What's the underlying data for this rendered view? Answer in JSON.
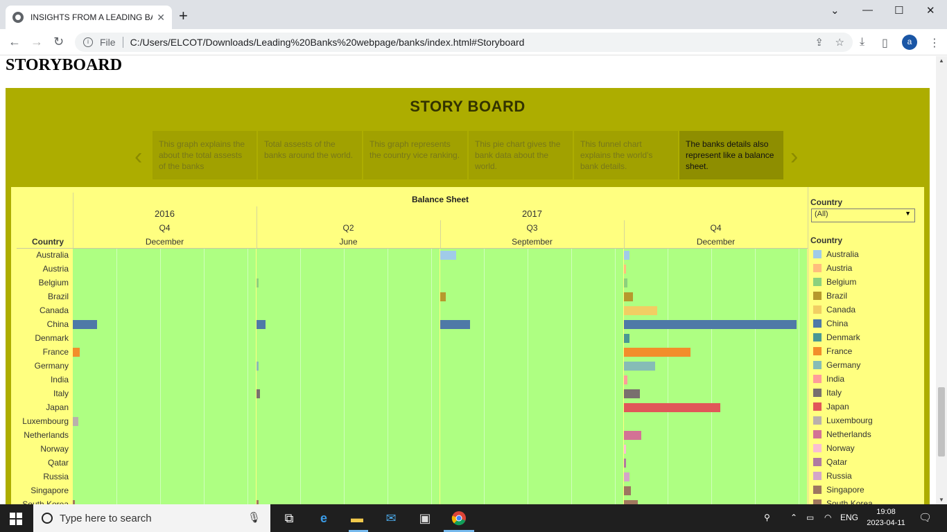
{
  "browser": {
    "tab_title": "INSIGHTS FROM A LEADING BAN",
    "new_tab": "+",
    "protocol_label": "File",
    "url": "C:/Users/ELCOT/Downloads/Leading%20Banks%20webpage/banks/index.html#Storyboard",
    "profile_initial": "a"
  },
  "page": {
    "heading": "STORYBOARD"
  },
  "story": {
    "title": "STORY BOARD",
    "points": [
      {
        "text": "This graph explains the about the total assests of the banks"
      },
      {
        "text": "Total assests of the banks around the world."
      },
      {
        "text": "This graph represents the country vice ranking."
      },
      {
        "text": "This pie chart gives the bank data about the world."
      },
      {
        "text": "This funnel chart explains the world's bank details."
      },
      {
        "text": "The banks details also represent like a balance sheet."
      }
    ]
  },
  "dashboard": {
    "filter_label": "Country",
    "filter_value": "(All)",
    "legend_title": "Country",
    "row_header": "Country"
  },
  "chart_data": {
    "type": "bar",
    "title": "Balance Sheet",
    "years": [
      "2016",
      "2017"
    ],
    "quarters": [
      "Q4",
      "Q2",
      "Q3",
      "Q4"
    ],
    "months": [
      "December",
      "June",
      "September",
      "December"
    ],
    "periods": [
      "2016 Q4 December",
      "2017 Q2 June",
      "2017 Q3 September",
      "2017 Q4 December"
    ],
    "categories": [
      "Australia",
      "Austria",
      "Belgium",
      "Brazil",
      "Canada",
      "China",
      "Denmark",
      "France",
      "Germany",
      "India",
      "Italy",
      "Japan",
      "Luxembourg",
      "Netherlands",
      "Norway",
      "Qatar",
      "Russia",
      "Singapore",
      "South Korea"
    ],
    "colors": [
      "#a0cbe8",
      "#ffbe7d",
      "#8cd17d",
      "#b6992d",
      "#f1ce63",
      "#4e79a7",
      "#499894",
      "#f28e2b",
      "#86bcb6",
      "#ff9d9a",
      "#79706e",
      "#e15759",
      "#bab0ac",
      "#d37295",
      "#fabfd2",
      "#b07aa1",
      "#d4a6c8",
      "#9d7660",
      "#a0785e"
    ],
    "series": [
      {
        "name": "2016 Q4 December",
        "values": [
          0,
          0,
          0,
          0,
          0,
          0.14,
          0,
          0.04,
          0,
          0,
          0,
          0,
          0.03,
          0,
          0,
          0,
          0,
          0,
          0.01
        ]
      },
      {
        "name": "2017 Q2 June",
        "values": [
          0,
          0,
          0.01,
          0,
          0,
          0.05,
          0,
          0,
          0.01,
          0,
          0.02,
          0,
          0,
          0,
          0,
          0,
          0,
          0,
          0.01
        ]
      },
      {
        "name": "2017 Q3 September",
        "values": [
          0.09,
          0,
          0,
          0.03,
          0,
          0.17,
          0,
          0,
          0,
          0,
          0,
          0,
          0,
          0,
          0,
          0,
          0,
          0,
          0
        ]
      },
      {
        "name": "2017 Q4 December",
        "values": [
          0.03,
          0.01,
          0.02,
          0.05,
          0.19,
          0.99,
          0.03,
          0.38,
          0.18,
          0.02,
          0.09,
          0.55,
          0,
          0.1,
          0.01,
          0.01,
          0.03,
          0.04,
          0.08
        ]
      }
    ],
    "xlim": [
      0,
      1
    ],
    "grid": true,
    "legend_position": "right"
  },
  "taskbar": {
    "search_placeholder": "Type here to search",
    "language": "ENG",
    "time": "19:08",
    "date": "2023-04-11"
  }
}
